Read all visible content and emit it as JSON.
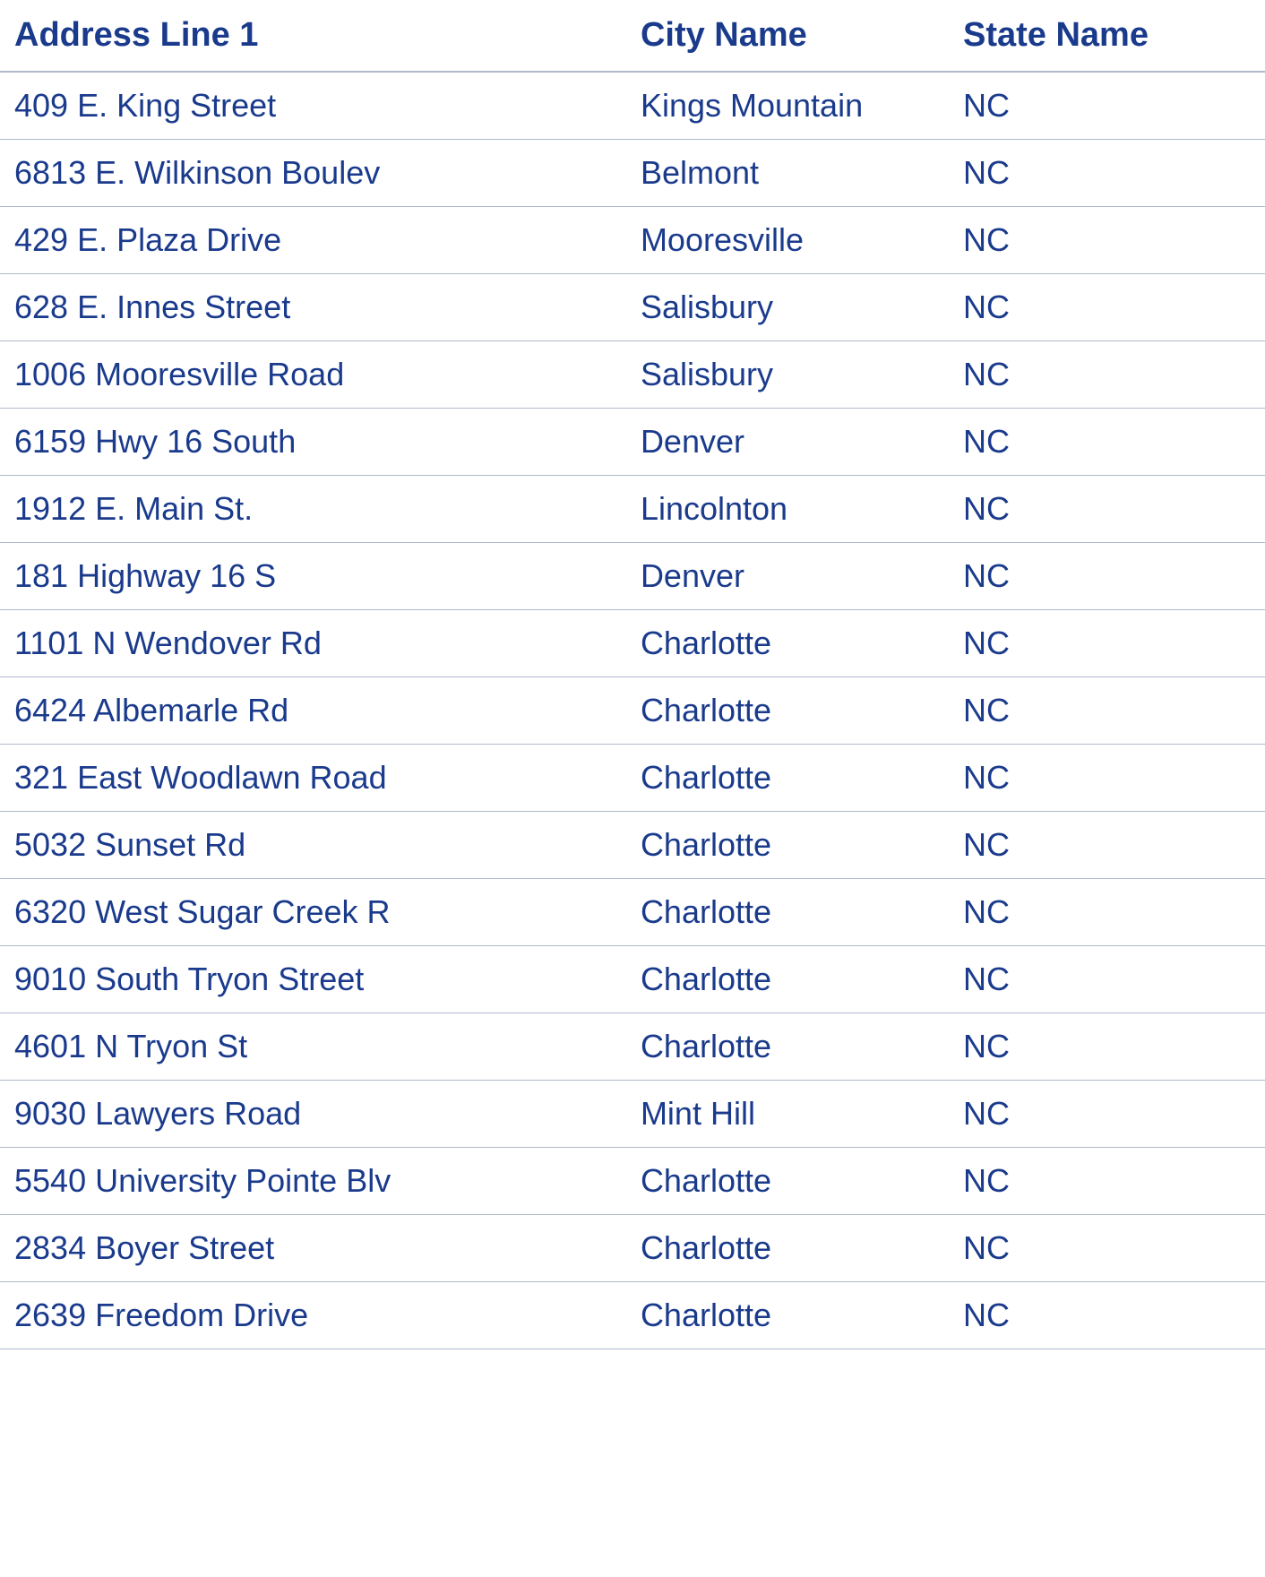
{
  "table": {
    "headers": {
      "address": "Address Line 1",
      "city": "City Name",
      "state": "State Name"
    },
    "rows": [
      {
        "address": "409 E. King Street",
        "city": "Kings Mountain",
        "state": "NC"
      },
      {
        "address": "6813 E. Wilkinson Boulev",
        "city": "Belmont",
        "state": "NC"
      },
      {
        "address": "429 E. Plaza Drive",
        "city": "Mooresville",
        "state": "NC"
      },
      {
        "address": "628 E. Innes Street",
        "city": "Salisbury",
        "state": "NC"
      },
      {
        "address": "1006 Mooresville Road",
        "city": "Salisbury",
        "state": "NC"
      },
      {
        "address": "6159 Hwy 16 South",
        "city": "Denver",
        "state": "NC"
      },
      {
        "address": "1912 E. Main St.",
        "city": "Lincolnton",
        "state": "NC"
      },
      {
        "address": "181 Highway 16 S",
        "city": "Denver",
        "state": "NC"
      },
      {
        "address": "1101 N Wendover Rd",
        "city": "Charlotte",
        "state": "NC"
      },
      {
        "address": "6424 Albemarle Rd",
        "city": "Charlotte",
        "state": "NC"
      },
      {
        "address": "321 East Woodlawn Road",
        "city": "Charlotte",
        "state": "NC"
      },
      {
        "address": "5032 Sunset Rd",
        "city": "Charlotte",
        "state": "NC"
      },
      {
        "address": "6320 West Sugar Creek R",
        "city": "Charlotte",
        "state": "NC"
      },
      {
        "address": "9010 South Tryon Street",
        "city": "Charlotte",
        "state": "NC"
      },
      {
        "address": "4601 N Tryon St",
        "city": "Charlotte",
        "state": "NC"
      },
      {
        "address": "9030 Lawyers Road",
        "city": "Mint Hill",
        "state": "NC"
      },
      {
        "address": "5540 University Pointe Blv",
        "city": "Charlotte",
        "state": "NC"
      },
      {
        "address": "2834 Boyer Street",
        "city": "Charlotte",
        "state": "NC"
      },
      {
        "address": "2639 Freedom Drive",
        "city": "Charlotte",
        "state": "NC"
      }
    ]
  }
}
